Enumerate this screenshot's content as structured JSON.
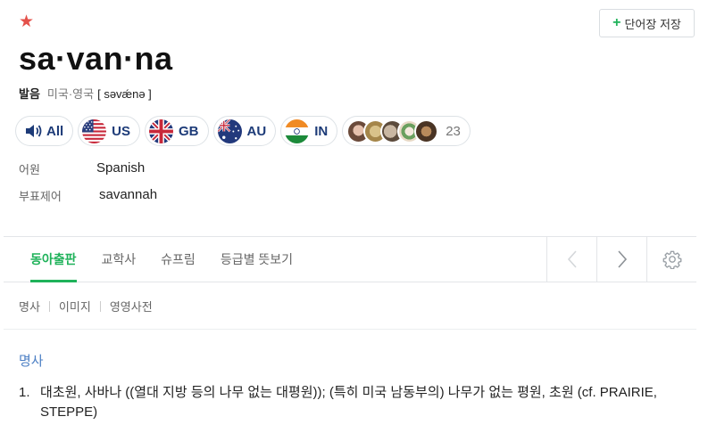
{
  "header": {
    "star_icon": "star-icon",
    "save_button_label": "단어장 저장",
    "save_button_icon": "plus-icon"
  },
  "entry": {
    "headword": "sa·van·na",
    "pronunciation": {
      "label": "발음",
      "region": "미국·영국",
      "ipa": "[ səvǽnə ]"
    },
    "audio_chips": [
      {
        "label": "All",
        "icon": "speaker-icon"
      },
      {
        "label": "US",
        "icon": "us-flag-icon"
      },
      {
        "label": "GB",
        "icon": "gb-flag-icon"
      },
      {
        "label": "AU",
        "icon": "au-flag-icon"
      },
      {
        "label": "IN",
        "icon": "in-flag-icon"
      }
    ],
    "user_recordings_count": "23",
    "etymology": {
      "key": "어원",
      "value": "Spanish"
    },
    "variant": {
      "key": "부표제어",
      "value": "savannah"
    }
  },
  "tabs": [
    {
      "label": "동아출판",
      "active": true
    },
    {
      "label": "교학사",
      "active": false
    },
    {
      "label": "슈프림",
      "active": false
    },
    {
      "label": "등급별 뜻보기",
      "active": false
    }
  ],
  "subnav": [
    "명사",
    "이미지",
    "영영사전"
  ],
  "definitions": {
    "pos": "명사",
    "items": [
      {
        "num": "1.",
        "text": "대초원, 사바나 ((열대 지방 등의 나무 없는 대평원)); (특히 미국 남동부의) 나무가 없는 평원, 초원 (cf. PRAIRIE, STEPPE)"
      }
    ]
  },
  "colors": {
    "accent_green": "#1fb25a",
    "star_red": "#e4514a",
    "pos_blue": "#4c7fc4",
    "chip_text": "#1d3b78"
  }
}
